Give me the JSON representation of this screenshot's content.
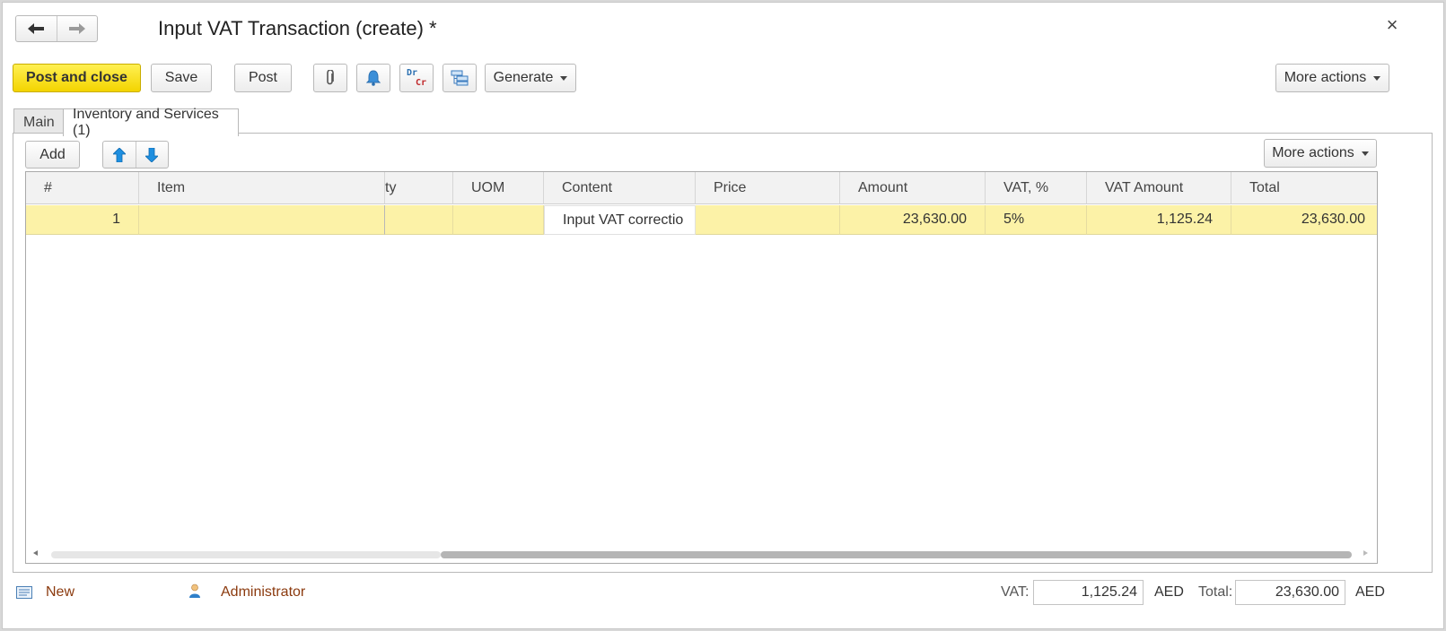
{
  "window": {
    "title": "Input VAT Transaction (create) *",
    "close_glyph": "×"
  },
  "nav": {
    "back_glyph": "🡐",
    "forward_glyph": "🡒"
  },
  "toolbar": {
    "post_and_close": "Post and close",
    "save": "Save",
    "post": "Post",
    "generate": "Generate",
    "more_actions": "More actions",
    "drcr_top": "Dr",
    "drcr_bottom": "Cr"
  },
  "tabs": [
    {
      "label": "Main"
    },
    {
      "label": "Inventory and Services (1)"
    }
  ],
  "table_toolbar": {
    "add": "Add",
    "more_actions": "More actions"
  },
  "table": {
    "columns": [
      "#",
      "Item",
      "ty",
      "UOM",
      "Content",
      "Price",
      "Amount",
      "VAT, %",
      "VAT Amount",
      "Total"
    ],
    "rows": [
      {
        "num": "1",
        "item": "",
        "qty": "",
        "uom": "",
        "content": "Input VAT correctio",
        "price": "",
        "amount": "23,630.00",
        "vat_rate": "5%",
        "vat_amount": "1,125.24",
        "total": "23,630.00"
      }
    ]
  },
  "footer": {
    "status": "New",
    "user": "Administrator",
    "vat_label": "VAT:",
    "vat_value": "1,125.24",
    "vat_currency": "AED",
    "total_label": "Total:",
    "total_value": "23,630.00",
    "total_currency": "AED"
  },
  "colors": {
    "primary_button": "#f3d400",
    "selected_row": "#fcf2a7",
    "link_text": "#8b3a0e",
    "arrow_blue": "#1e8fe0"
  }
}
